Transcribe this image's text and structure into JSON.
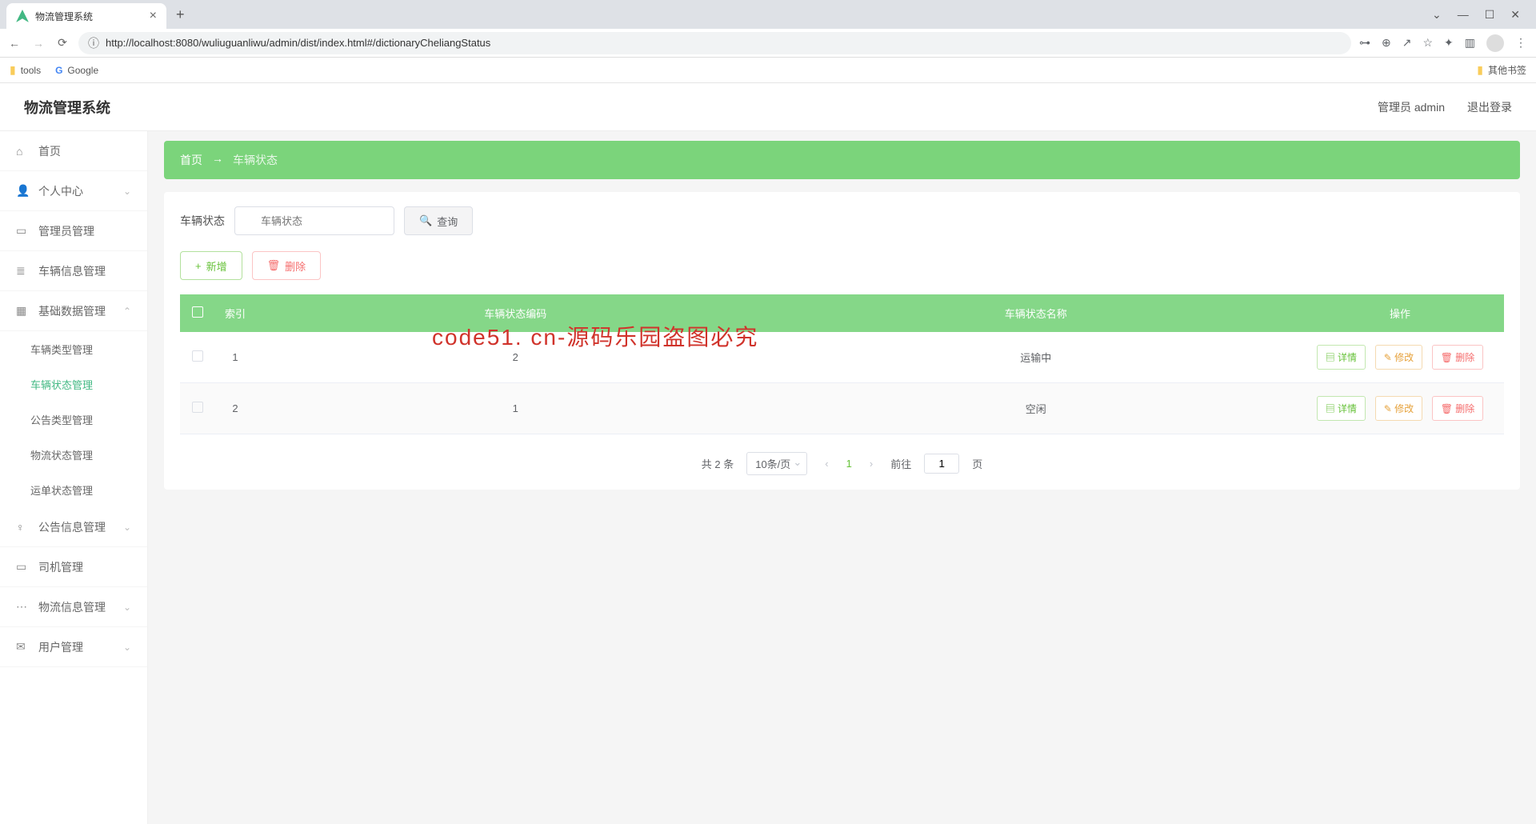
{
  "browser": {
    "tab_title": "物流管理系统",
    "url": "http://localhost:8080/wuliuguanliwu/admin/dist/index.html#/dictionaryCheliangStatus",
    "bookmarks": {
      "tools": "tools",
      "google": "Google",
      "other": "其他书签"
    }
  },
  "header": {
    "app_title": "物流管理系统",
    "user_label": "管理员 admin",
    "logout": "退出登录"
  },
  "sidebar": {
    "home": "首页",
    "personal": "个人中心",
    "admin_mgmt": "管理员管理",
    "vehicle_info": "车辆信息管理",
    "base_data": "基础数据管理",
    "sub_vehicle_type": "车辆类型管理",
    "sub_vehicle_status": "车辆状态管理",
    "sub_notice_type": "公告类型管理",
    "sub_logistics_status": "物流状态管理",
    "sub_waybill_status": "运单状态管理",
    "notice_mgmt": "公告信息管理",
    "driver_mgmt": "司机管理",
    "logistics_mgmt": "物流信息管理",
    "user_mgmt": "用户管理"
  },
  "breadcrumb": {
    "home": "首页",
    "current": "车辆状态"
  },
  "search": {
    "label": "车辆状态",
    "placeholder": "车辆状态",
    "query_btn": "查询",
    "add_btn": "新增",
    "delete_btn": "删除"
  },
  "table": {
    "headers": {
      "index": "索引",
      "code": "车辆状态编码",
      "name": "车辆状态名称",
      "ops": "操作"
    },
    "rows": [
      {
        "idx": "1",
        "code": "2",
        "name": "运输中"
      },
      {
        "idx": "2",
        "code": "1",
        "name": "空闲"
      }
    ],
    "ops": {
      "detail": "详情",
      "edit": "修改",
      "delete": "删除"
    }
  },
  "pagination": {
    "total": "共 2 条",
    "per_page": "10条/页",
    "current": "1",
    "goto_prefix": "前往",
    "goto_suffix": "页",
    "input": "1"
  },
  "watermark": "code51. cn-源码乐园盗图必究"
}
